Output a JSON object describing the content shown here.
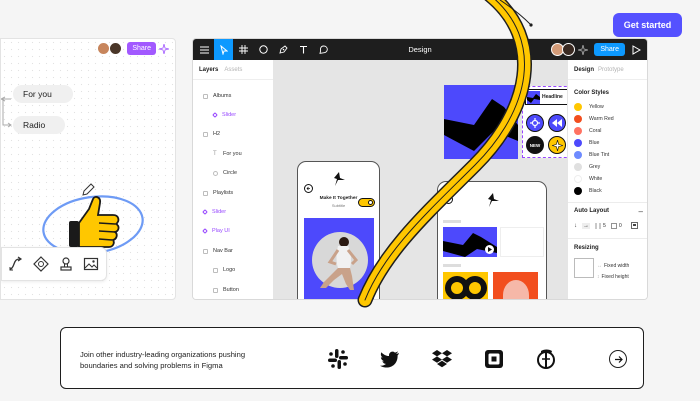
{
  "header": {
    "cta_label": "Get started"
  },
  "whiteboard": {
    "share_label": "Share",
    "pills": [
      "For you",
      "Radio"
    ],
    "colors": {
      "purple": "#a259ff"
    }
  },
  "editor": {
    "title": "Design",
    "share_label": "Share",
    "layers_panel": {
      "tabs": [
        "Layers",
        "Assets"
      ],
      "items": [
        {
          "label": "Albums",
          "component": false
        },
        {
          "label": "Slider",
          "component": true
        },
        {
          "label": "H2",
          "component": false
        },
        {
          "label": "For you",
          "component": false
        },
        {
          "label": "Circle",
          "component": false
        },
        {
          "label": "Playlists",
          "component": false
        },
        {
          "label": "Slider",
          "component": true
        },
        {
          "label": "Play UI",
          "component": true
        },
        {
          "label": "Nav Bar",
          "component": false
        },
        {
          "label": "Logo",
          "component": false
        },
        {
          "label": "Button",
          "component": false
        }
      ]
    },
    "canvas": {
      "headline_label": "Headline",
      "new_badge": "NEW",
      "phone_title": "Make It Together",
      "phone_subtitle": "Subtitle"
    },
    "properties_panel": {
      "tabs": [
        "Design",
        "Prototype"
      ],
      "color_styles_heading": "Color Styles",
      "color_styles": [
        {
          "name": "Yellow",
          "hex": "#ffc700"
        },
        {
          "name": "Warm Red",
          "hex": "#f24e1e"
        },
        {
          "name": "Coral",
          "hex": "#ff7262"
        },
        {
          "name": "Blue",
          "hex": "#4d49fc"
        },
        {
          "name": "Blue Tint",
          "hex": "#6e8bff"
        },
        {
          "name": "Grey",
          "hex": "#e0e0e0"
        },
        {
          "name": "White",
          "hex": "#ffffff"
        },
        {
          "name": "Black",
          "hex": "#000000"
        }
      ],
      "auto_layout_heading": "Auto Layout",
      "auto_layout_gap": "5",
      "auto_layout_padding": "0",
      "resizing_heading": "Resizing",
      "resizing_width": "Fixed width",
      "resizing_height": "Fixed height"
    }
  },
  "partners": {
    "text": "Join other industry-leading organizations pushing boundaries and solving problems in Figma",
    "logos": [
      "slack-icon",
      "twitter-icon",
      "dropbox-icon",
      "square-icon",
      "nytimes-icon"
    ]
  },
  "colors": {
    "brand": "#5551ff",
    "accent_blue": "#0d99ff",
    "ribbon_yellow": "#ffc700"
  }
}
